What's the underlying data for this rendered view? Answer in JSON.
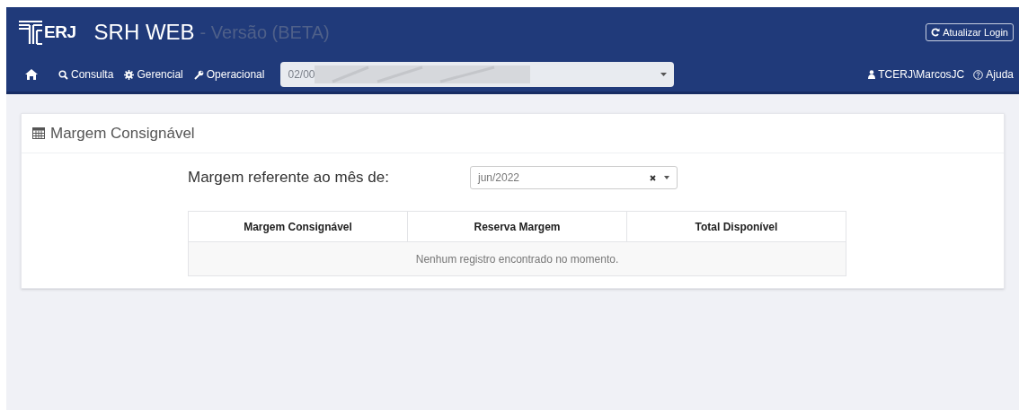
{
  "header": {
    "logo_text": "ERJ",
    "title": "SRH WEB",
    "subtitle": "- Versão (BETA)",
    "refresh_button": "Atualizar Login"
  },
  "nav": {
    "items": [
      {
        "kind": "home"
      },
      {
        "kind": "search",
        "label": "Consulta"
      },
      {
        "kind": "gear",
        "label": "Gerencial"
      },
      {
        "kind": "wrench",
        "label": "Operacional"
      }
    ],
    "select_value": "02/00",
    "user": "TCERJ\\MarcosJC",
    "help": "Ajuda"
  },
  "panel": {
    "title": "Margem Consignável",
    "month_label": "Margem referente ao mês de:",
    "month_value": "jun/2022",
    "table": {
      "columns": [
        "Margem Consignável",
        "Reserva Margem",
        "Total Disponível"
      ],
      "empty_message": "Nenhum registro encontrado no momento."
    }
  }
}
